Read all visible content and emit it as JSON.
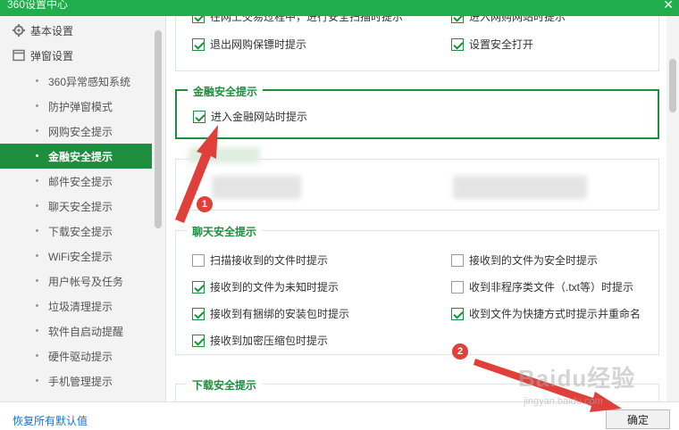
{
  "window": {
    "title": "360设置中心",
    "close_glyph": "✕"
  },
  "sidebar": {
    "groups": [
      {
        "label": "基本设置",
        "icon": "gear-icon"
      },
      {
        "label": "弹窗设置",
        "icon": "window-icon"
      }
    ],
    "items": [
      {
        "label": "360异常感知系统"
      },
      {
        "label": "防护弹窗模式"
      },
      {
        "label": "网购安全提示"
      },
      {
        "label": "金融安全提示",
        "active": true
      },
      {
        "label": "邮件安全提示"
      },
      {
        "label": "聊天安全提示"
      },
      {
        "label": "下载安全提示"
      },
      {
        "label": "WiFi安全提示"
      },
      {
        "label": "用户帐号及任务"
      },
      {
        "label": "垃圾清理提示"
      },
      {
        "label": "软件自启动提醒"
      },
      {
        "label": "硬件驱动提示"
      },
      {
        "label": "手机管理提示"
      }
    ]
  },
  "shopping": {
    "partial_left": "在网上交易过程中，进行安全扫描时提示",
    "partial_right": "进入网购网站时提示",
    "items": [
      {
        "label": "退出网购保镖时提示",
        "checked": true
      },
      {
        "label": "设置安全打开",
        "checked": true
      }
    ]
  },
  "finance": {
    "title": "金融安全提示",
    "items": [
      {
        "label": "进入金融网站时提示",
        "checked": true
      }
    ],
    "accent": "#1e8e3e"
  },
  "chat": {
    "title": "聊天安全提示",
    "items": [
      {
        "label": "扫描接收到的文件时提示",
        "checked": false
      },
      {
        "label": "接收到的文件为安全时提示",
        "checked": false
      },
      {
        "label": "接收到的文件为未知时提示",
        "checked": true
      },
      {
        "label": "收到非程序类文件（.txt等）时提示",
        "checked": false
      },
      {
        "label": "接收到有捆绑的安装包时提示",
        "checked": true
      },
      {
        "label": "收到文件为快捷方式时提示并重命名",
        "checked": true
      },
      {
        "label": "接收到加密压缩包时提示",
        "checked": true
      }
    ]
  },
  "download": {
    "title": "下载安全提示"
  },
  "footer": {
    "reset_label": "恢复所有默认值",
    "ok_label": "确定"
  },
  "annotations": {
    "badge1": "1",
    "badge2": "2",
    "color": "#e0403b"
  },
  "watermark": {
    "text": "Baidu经验",
    "sub": "jingyan.baidu.com"
  }
}
